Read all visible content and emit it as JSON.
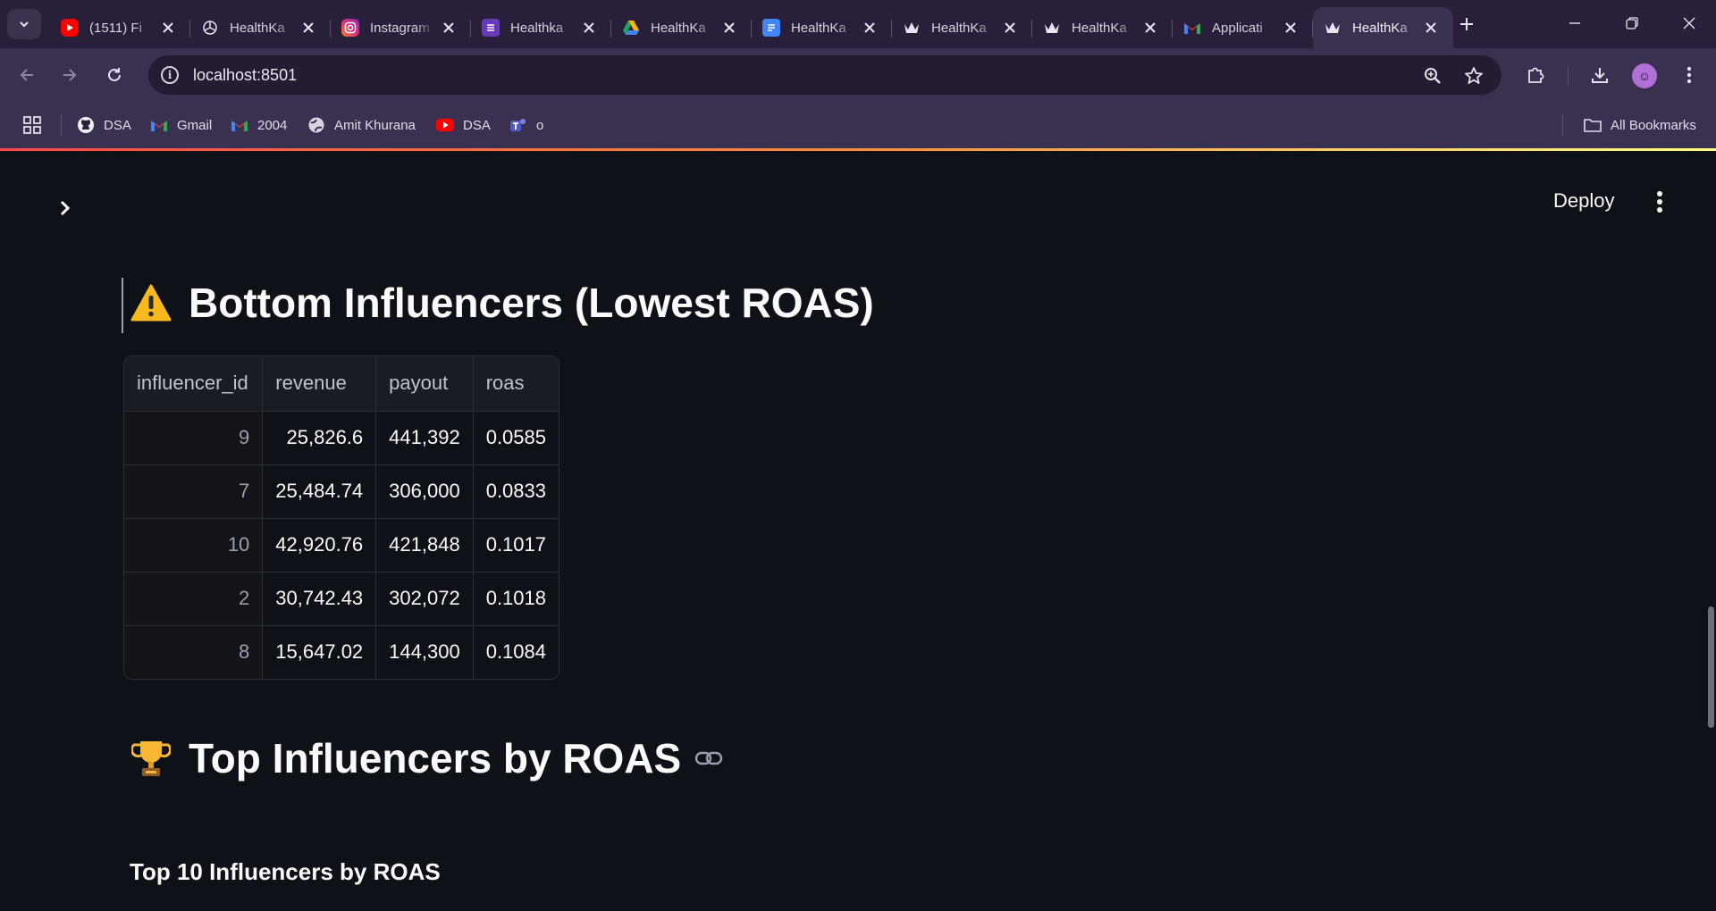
{
  "browser": {
    "tabs": [
      {
        "title": "(1511) Fi",
        "icon": "youtube-icon",
        "color": "#ff0000"
      },
      {
        "title": "HealthKa",
        "icon": "openai-icon",
        "color": "#ffffff"
      },
      {
        "title": "Instagram",
        "icon": "instagram-icon",
        "color": "#e1306c"
      },
      {
        "title": "Healthka",
        "icon": "forms-icon",
        "color": "#673ab7"
      },
      {
        "title": "HealthKa",
        "icon": "drive-icon",
        "color": "#1fa463"
      },
      {
        "title": "HealthKa",
        "icon": "docs-icon",
        "color": "#4285f4"
      },
      {
        "title": "HealthKa",
        "icon": "streamlit-crown-icon",
        "color": "#ffffff"
      },
      {
        "title": "HealthKa",
        "icon": "streamlit-crown-icon",
        "color": "#ffffff"
      },
      {
        "title": "Applicati",
        "icon": "gmail-icon",
        "color": "#ea4335"
      },
      {
        "title": "HealthKa",
        "icon": "streamlit-crown-icon",
        "color": "#ffffff",
        "active": true
      }
    ],
    "url": "localhost:8501",
    "bookmarks": [
      {
        "label": "DSA",
        "icon": "github-icon"
      },
      {
        "label": "Gmail",
        "icon": "gmail-icon"
      },
      {
        "label": "2004",
        "icon": "gmail-icon"
      },
      {
        "label": "Amit Khurana",
        "icon": "globe-icon"
      },
      {
        "label": "DSA",
        "icon": "youtube-icon"
      },
      {
        "label": "o",
        "icon": "teams-icon"
      }
    ],
    "all_bookmarks": "All Bookmarks"
  },
  "app": {
    "deploy_label": "Deploy",
    "bottom_section": {
      "emoji": "⚠️",
      "title": "Bottom Influencers (Lowest ROAS)"
    },
    "table": {
      "columns": [
        "influencer_id",
        "revenue",
        "payout",
        "roas"
      ],
      "rows": [
        {
          "influencer_id": "9",
          "revenue": "25,826.6",
          "payout": "441,392",
          "roas": "0.0585"
        },
        {
          "influencer_id": "7",
          "revenue": "25,484.74",
          "payout": "306,000",
          "roas": "0.0833"
        },
        {
          "influencer_id": "10",
          "revenue": "42,920.76",
          "payout": "421,848",
          "roas": "0.1017"
        },
        {
          "influencer_id": "2",
          "revenue": "30,742.43",
          "payout": "302,072",
          "roas": "0.1018"
        },
        {
          "influencer_id": "8",
          "revenue": "15,647.02",
          "payout": "144,300",
          "roas": "0.1084"
        }
      ]
    },
    "top_section": {
      "emoji": "🏆",
      "title": "Top Influencers by ROAS"
    },
    "subheading": "Top 10 Influencers by ROAS"
  }
}
